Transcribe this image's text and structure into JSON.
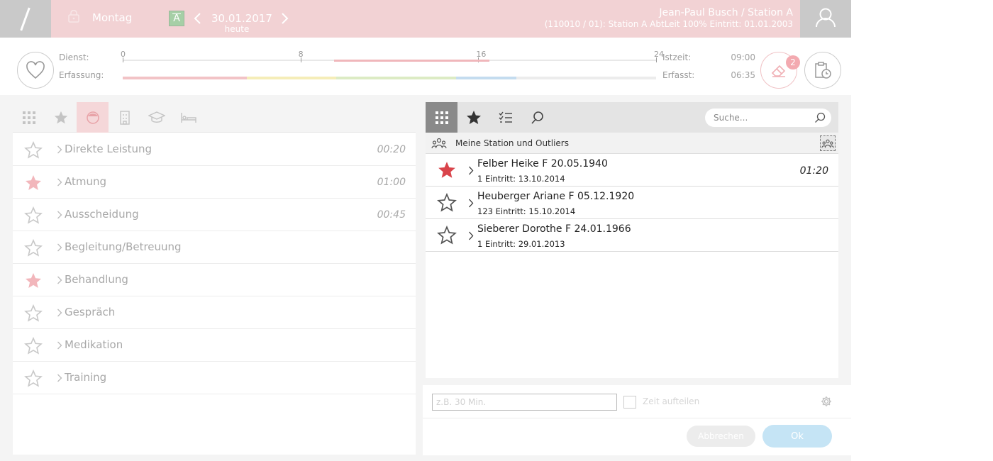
{
  "header": {
    "day": "Montag",
    "date": "30.01.2017",
    "today": "heute",
    "a_label": "A",
    "user_name": "Jean-Paul Busch / Station A",
    "user_details": "(110010 / 01): Station A AbtLeit 100% Eintritt: 01.01.2003",
    "colors": {
      "header_bg": "#f2d2d4",
      "side_box": "#c9c9c9"
    }
  },
  "stats": {
    "dienst_label": "Dienst:",
    "erfassung_label": "Erfassung:",
    "ticks": [
      "0",
      "8",
      "16",
      "24"
    ],
    "dienst_range_hours": [
      9.5,
      16.5
    ],
    "erfassung_segments": [
      {
        "from": 0,
        "to": 5.6,
        "color": "#f2c3c6"
      },
      {
        "from": 5.6,
        "to": 9.6,
        "color": "#f5edb8"
      },
      {
        "from": 9.6,
        "to": 15,
        "color": "#dcebc4"
      },
      {
        "from": 15,
        "to": 17.7,
        "color": "#c4dcef"
      },
      {
        "from": 17.7,
        "to": 24,
        "color": "#ececec"
      }
    ],
    "istzeit_label": "Istzeit:",
    "istzeit_value": "09:00",
    "erfasst_label": "Erfasst:",
    "erfasst_value": "06:35",
    "badge_count": "2"
  },
  "left": {
    "tab_icons": [
      "grid-icon",
      "star-icon",
      "face-icon",
      "building-icon",
      "graduation-cap-icon",
      "bed-icon"
    ],
    "active_tab": 2,
    "categories": [
      {
        "label": "Direkte Leistung",
        "time": "00:20",
        "starred": false
      },
      {
        "label": "Atmung",
        "time": "01:00",
        "starred": true
      },
      {
        "label": "Ausscheidung",
        "time": "00:45",
        "starred": false
      },
      {
        "label": "Begleitung/Betreuung",
        "time": "",
        "starred": false
      },
      {
        "label": "Behandlung",
        "time": "",
        "starred": true
      },
      {
        "label": "Gespräch",
        "time": "",
        "starred": false
      },
      {
        "label": "Medikation",
        "time": "",
        "starred": false
      },
      {
        "label": "Training",
        "time": "",
        "starred": false
      }
    ]
  },
  "right": {
    "tab_icons": [
      "grid-icon",
      "star-icon",
      "checklist-icon",
      "search-icon"
    ],
    "active_tab": 0,
    "search_placeholder": "Suche...",
    "station_label": "Meine Station und Outliers",
    "patients": [
      {
        "name": "Felber Heike F 20.05.1940",
        "sub": "1 Eintritt: 13.10.2014",
        "time": "01:20",
        "starred": true
      },
      {
        "name": "Heuberger Ariane F 05.12.1920",
        "sub": "123 Eintritt: 15.10.2014",
        "time": "",
        "starred": false
      },
      {
        "name": "Sieberer Dorothe F 24.01.1966",
        "sub": "1 Eintritt: 29.01.2013",
        "time": "",
        "starred": false
      }
    ]
  },
  "form": {
    "time_placeholder": "z.B. 30 Min.",
    "split_label": "Zeit aufteilen",
    "cancel_label": "Abbrechen",
    "ok_label": "Ok"
  }
}
